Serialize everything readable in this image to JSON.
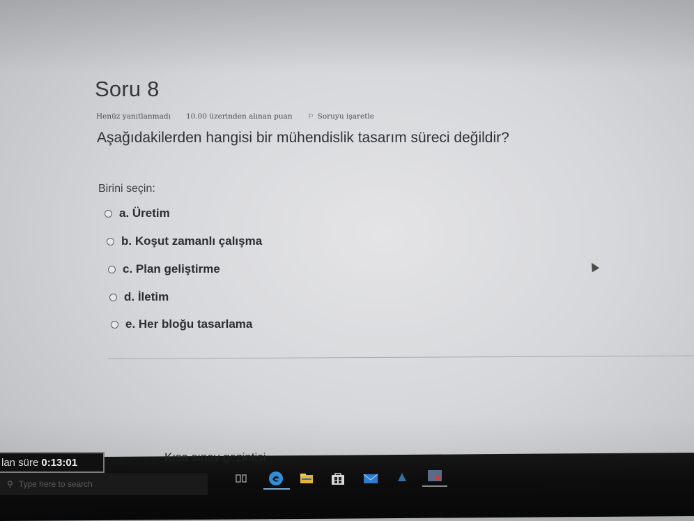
{
  "question": {
    "title": "Soru 8",
    "status": "Henüz yanıtlanmadı",
    "points": "10.00 üzerinden alınan puan",
    "flag_label": "Soruyu işaretle",
    "text": "Aşağıdakilerden hangisi bir mühendislik tasarım süreci değildir?"
  },
  "answer": {
    "prompt": "Birini seçin:",
    "options": [
      {
        "label": "a. Üretim",
        "selected": false
      },
      {
        "label": "b. Koşut zamanlı çalışma",
        "selected": false
      },
      {
        "label": "c. Plan geliştirme",
        "selected": false
      },
      {
        "label": "d. İletim",
        "selected": false
      },
      {
        "label": "e. Her bloğu tasarlama",
        "selected": false
      }
    ]
  },
  "timer": {
    "label": "lan süre",
    "time": "0:13:01"
  },
  "navigation": {
    "quiz_nav": "Kısa sınav gezintisi"
  },
  "taskbar": {
    "search_placeholder": "Type here to search",
    "icons": [
      "search-icon",
      "task-view-icon",
      "edge-icon",
      "file-explorer-icon",
      "store-icon",
      "mail-icon",
      "app-icon",
      "photos-icon"
    ]
  },
  "colors": {
    "page_bg": "#d9dadc",
    "taskbar_bg": "#0d0d0d",
    "edge_blue": "#2f8fd8",
    "accent_underline": "#7aa9d6"
  }
}
